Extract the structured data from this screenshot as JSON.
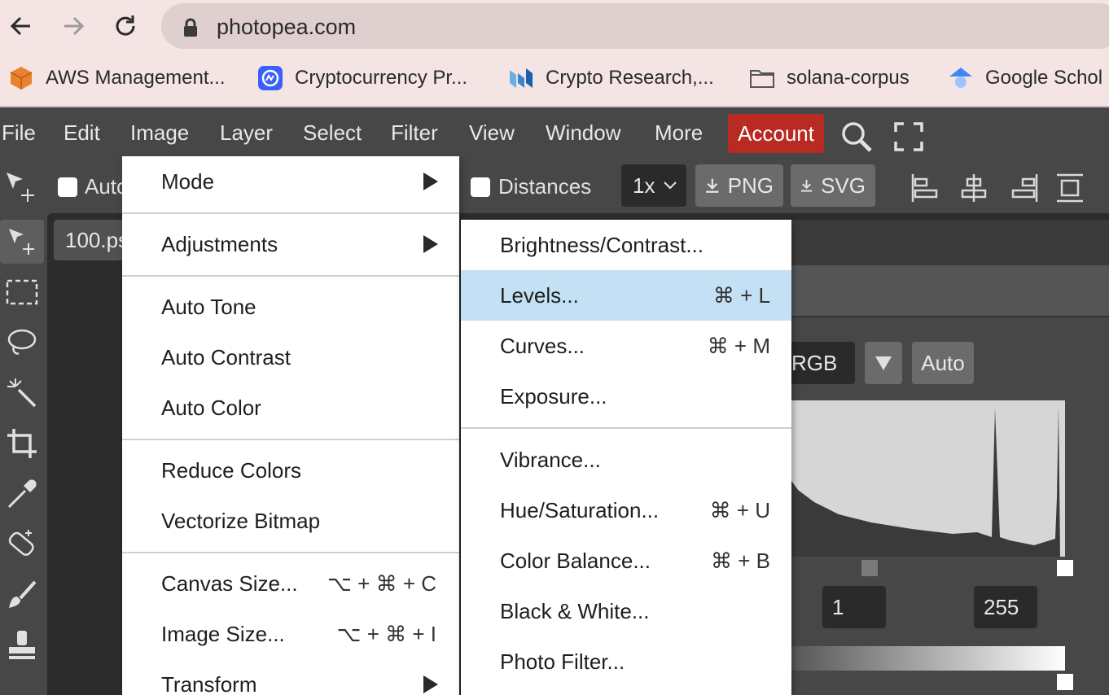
{
  "browser": {
    "url": "photopea.com",
    "bookmarks": [
      {
        "label": "AWS Management...",
        "icon": "aws-cube-icon"
      },
      {
        "label": "Cryptocurrency Pr...",
        "icon": "coinmarketcap-icon"
      },
      {
        "label": "Crypto Research,...",
        "icon": "messari-icon"
      },
      {
        "label": "solana-corpus",
        "icon": "folder-icon"
      },
      {
        "label": "Google Schol",
        "icon": "google-scholar-icon"
      }
    ]
  },
  "menubar": {
    "items": [
      "File",
      "Edit",
      "Image",
      "Layer",
      "Select",
      "Filter",
      "View",
      "Window",
      "More"
    ],
    "account": "Account"
  },
  "options": {
    "auto_select": "Auto",
    "distances": "Distances",
    "zoom": "1x",
    "png": "PNG",
    "svg": "SVG"
  },
  "document": {
    "tab": "100.psd"
  },
  "levels_panel": {
    "channel": "RGB",
    "auto": "Auto",
    "mid": "1",
    "white": "255"
  },
  "image_menu": {
    "items": [
      {
        "label": "Mode",
        "submenu": true
      },
      {
        "label": "Adjustments",
        "submenu": true
      },
      {
        "label": "Auto Tone"
      },
      {
        "label": "Auto Contrast"
      },
      {
        "label": "Auto Color"
      },
      {
        "label": "Reduce Colors"
      },
      {
        "label": "Vectorize Bitmap"
      },
      {
        "label": "Canvas Size...",
        "shortcut": "⌥ + ⌘ + C"
      },
      {
        "label": "Image Size...",
        "shortcut": "⌥ + ⌘ + I"
      },
      {
        "label": "Transform",
        "submenu": true
      }
    ]
  },
  "adjustments_menu": {
    "items": [
      {
        "label": "Brightness/Contrast..."
      },
      {
        "label": "Levels...",
        "shortcut": "⌘ + L",
        "highlighted": true
      },
      {
        "label": "Curves...",
        "shortcut": "⌘ + M"
      },
      {
        "label": "Exposure..."
      },
      {
        "label": "Vibrance..."
      },
      {
        "label": "Hue/Saturation...",
        "shortcut": "⌘ + U"
      },
      {
        "label": "Color Balance...",
        "shortcut": "⌘ + B"
      },
      {
        "label": "Black & White..."
      },
      {
        "label": "Photo Filter..."
      }
    ]
  },
  "colors": {
    "account": "#b82a22",
    "highlight": "#c3e0f5",
    "app_bg": "#474747"
  }
}
